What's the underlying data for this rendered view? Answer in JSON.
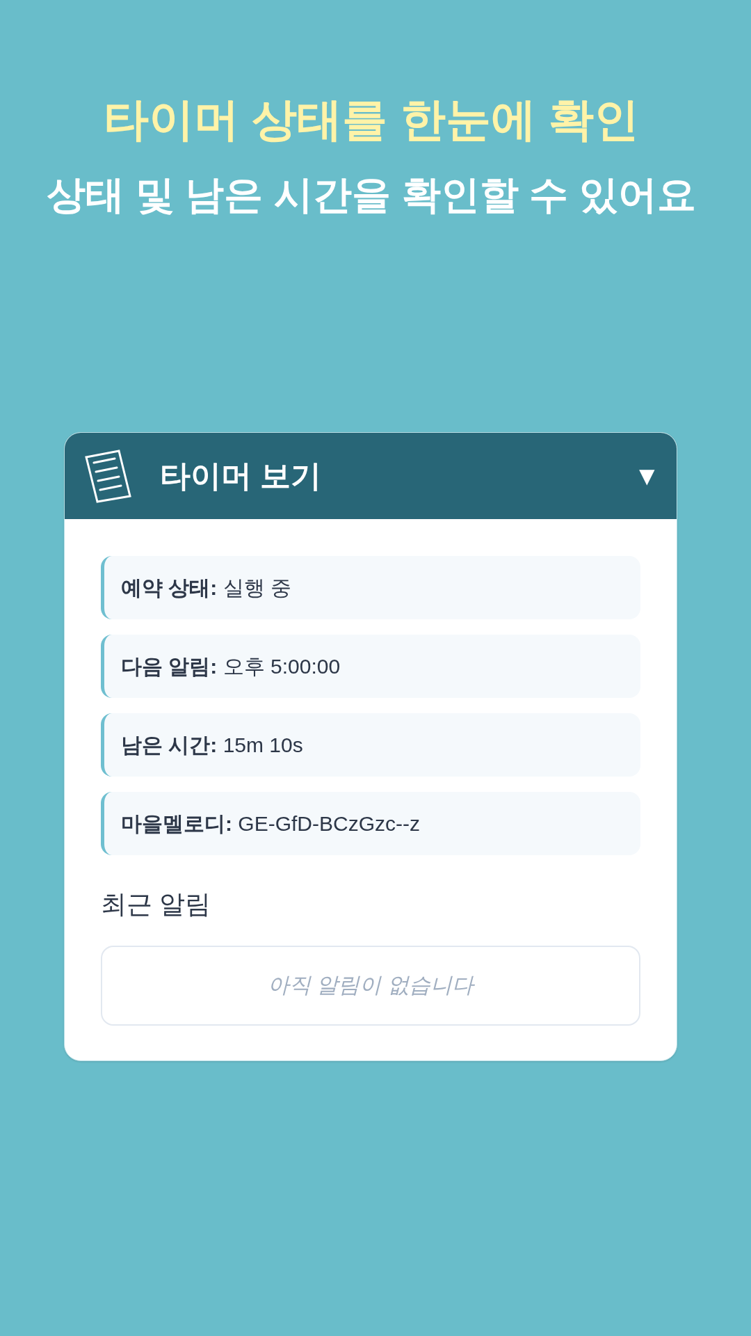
{
  "headline": {
    "title": "타이머 상태를 한눈에 확인",
    "subtitle": "상태 및 남은 시간을 확인할 수 있어요"
  },
  "panel": {
    "title": "타이머 보기",
    "toggle": "▼",
    "expanded": true,
    "rows": [
      {
        "label": "예약 상태:",
        "value": "실행 중"
      },
      {
        "label": "다음 알림:",
        "value": "오후 5:00:00"
      },
      {
        "label": "남은 시간:",
        "value": "15m 10s"
      },
      {
        "label": "마을멜로디:",
        "value": "GE-GfD-BCzGzc--z"
      }
    ],
    "recent": {
      "title": "최근 알림",
      "empty_message": "아직 알림이 없습니다"
    }
  }
}
